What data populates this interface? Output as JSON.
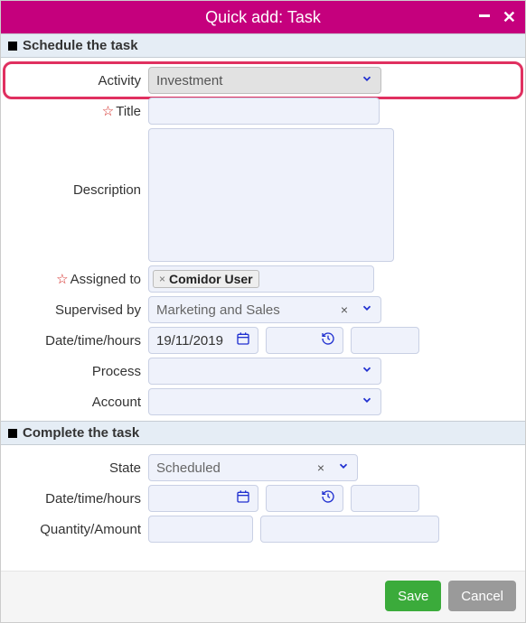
{
  "title_bar": {
    "title": "Quick add: Task"
  },
  "sections": {
    "schedule": "Schedule the task",
    "complete": "Complete the task"
  },
  "labels": {
    "activity": "Activity",
    "title": "Title",
    "description": "Description",
    "assigned_to": "Assigned to",
    "supervised_by": "Supervised by",
    "date_time_hours": "Date/time/hours",
    "process": "Process",
    "account": "Account",
    "state": "State",
    "quantity_amount": "Quantity/Amount"
  },
  "values": {
    "activity": "Investment",
    "title": "",
    "description": "",
    "assigned_to_tag": "Comidor User",
    "supervised_by": "Marketing and Sales",
    "schedule_date": "19/11/2019",
    "schedule_time": "",
    "schedule_hours": "",
    "process": "",
    "account": "",
    "state": "Scheduled",
    "complete_date": "",
    "complete_time": "",
    "complete_hours": "",
    "qty": "",
    "amount": ""
  },
  "buttons": {
    "save": "Save",
    "cancel": "Cancel"
  }
}
